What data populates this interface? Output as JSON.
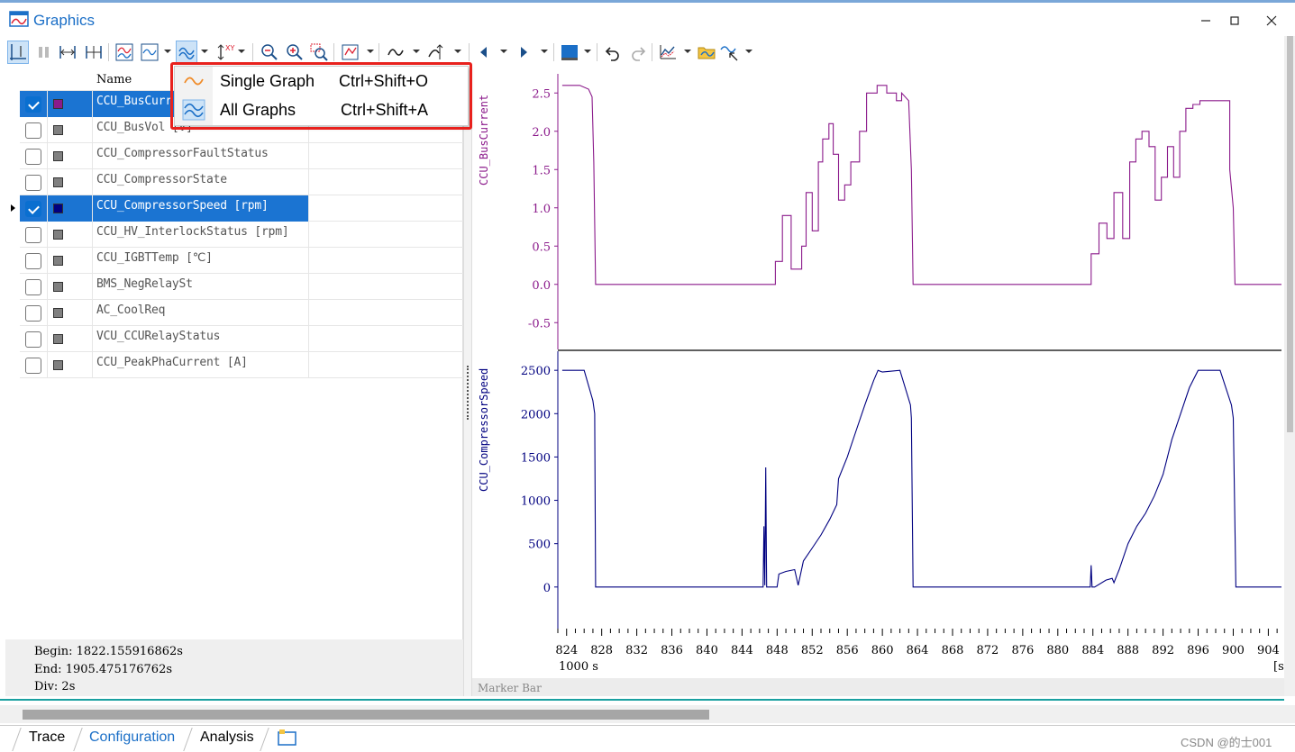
{
  "window": {
    "title": "Graphics",
    "controls": [
      "minimize-icon",
      "maximize-icon",
      "close-icon"
    ]
  },
  "toolbar": {
    "icons": [
      "layout-icon",
      "pause-icon",
      "fit-x-icon",
      "fit-xy-icon",
      "graph-mode-icon",
      "signal-mode-icon",
      "graph-layout-icon",
      "scale-icon",
      "zoom-out-icon",
      "zoom-in-icon",
      "zoom-rect-icon",
      "measure-icon",
      "curve-icon",
      "cursor-icon",
      "prev-icon",
      "next-icon",
      "background-icon",
      "undo-icon",
      "redo-icon",
      "chart-options-icon",
      "export-icon",
      "signal-config-icon"
    ]
  },
  "menu": {
    "items": [
      {
        "label": "Single Graph",
        "shortcut": "Ctrl+Shift+O",
        "icon": "single-graph-icon"
      },
      {
        "label": "All Graphs",
        "shortcut": "Ctrl+Shift+A",
        "icon": "all-graphs-icon"
      }
    ]
  },
  "signal_list": {
    "header_name": "Name",
    "rows": [
      {
        "name": "CCU_BusCurr",
        "checked": true,
        "color": "#8b1a8b",
        "selected": true
      },
      {
        "name": "CCU_BusVol    [V]",
        "checked": false,
        "color": "#808080",
        "selected": false
      },
      {
        "name": "CCU_CompressorFaultStatus",
        "checked": false,
        "color": "#808080",
        "selected": false
      },
      {
        "name": "CCU_CompressorState",
        "checked": false,
        "color": "#808080",
        "selected": false
      },
      {
        "name": "CCU_CompressorSpeed [rpm]",
        "checked": true,
        "color": "#000080",
        "selected": true
      },
      {
        "name": "CCU_HV_InterlockStatus [rpm]",
        "checked": false,
        "color": "#808080",
        "selected": false
      },
      {
        "name": "CCU_IGBTTemp [℃]",
        "checked": false,
        "color": "#808080",
        "selected": false
      },
      {
        "name": "BMS_NegRelaySt",
        "checked": false,
        "color": "#808080",
        "selected": false
      },
      {
        "name": "AC_CoolReq",
        "checked": false,
        "color": "#808080",
        "selected": false
      },
      {
        "name": "VCU_CCURelayStatus",
        "checked": false,
        "color": "#808080",
        "selected": false
      },
      {
        "name": "CCU_PeakPhaCurrent [A]",
        "checked": false,
        "color": "#808080",
        "selected": false
      }
    ]
  },
  "status": {
    "begin": "Begin: 1822.155916862s",
    "end": "End: 1905.475176762s",
    "div": "Div: 2s"
  },
  "marker_bar": "Marker Bar",
  "tabs": [
    {
      "label": "Trace",
      "active": false
    },
    {
      "label": "Configuration",
      "active": true
    },
    {
      "label": "Analysis",
      "active": false
    }
  ],
  "watermark": "CSDN @的士001",
  "chart_data": [
    {
      "type": "line",
      "ylabel": "CCU_BusCurrent",
      "color": "#8b1a8b",
      "ylim": [
        -0.85,
        2.75
      ],
      "yticks": [
        "2.5",
        "2.0",
        "1.5",
        "1.0",
        "0.5",
        "0.0",
        "-0.5"
      ],
      "x": [
        823.5,
        825.5,
        826.5,
        826.9,
        827.1,
        827.3,
        847.8,
        847.8,
        848.6,
        848.6,
        849.6,
        849.6,
        850.8,
        850.8,
        851.3,
        851.3,
        852.0,
        852.0,
        852.7,
        852.7,
        853.2,
        853.2,
        853.9,
        853.9,
        854.4,
        854.4,
        855.0,
        855.0,
        855.7,
        855.7,
        856.4,
        856.4,
        857.4,
        857.4,
        858.2,
        858.2,
        859.4,
        859.4,
        860.5,
        860.5,
        861.6,
        861.6,
        862.2,
        862.2,
        863.0,
        863.3,
        863.5,
        883.8,
        883.8,
        884.7,
        884.7,
        885.6,
        885.6,
        886.4,
        886.4,
        887.4,
        887.4,
        888.2,
        888.2,
        888.9,
        888.9,
        889.6,
        889.6,
        890.4,
        890.4,
        891.1,
        891.1,
        891.8,
        891.8,
        892.5,
        892.5,
        893.2,
        893.2,
        893.9,
        893.9,
        894.6,
        894.6,
        895.4,
        895.4,
        896.2,
        896.2,
        899.6,
        899.6,
        900.0,
        900.2,
        900.5,
        905.5
      ],
      "y": [
        2.6,
        2.6,
        2.55,
        2.45,
        1.6,
        0.0,
        0.0,
        0.3,
        0.3,
        0.9,
        0.9,
        0.2,
        0.2,
        0.5,
        0.5,
        1.2,
        1.2,
        0.7,
        0.7,
        1.6,
        1.6,
        1.9,
        1.9,
        2.1,
        2.1,
        1.7,
        1.7,
        1.1,
        1.1,
        1.3,
        1.3,
        1.6,
        1.6,
        2.0,
        2.0,
        2.5,
        2.5,
        2.6,
        2.6,
        2.5,
        2.5,
        2.4,
        2.4,
        2.5,
        2.4,
        1.5,
        0.0,
        0.0,
        0.4,
        0.4,
        0.8,
        0.8,
        0.6,
        0.6,
        1.2,
        1.2,
        0.6,
        0.6,
        1.6,
        1.6,
        1.9,
        1.9,
        2.0,
        2.0,
        1.8,
        1.8,
        1.1,
        1.1,
        1.4,
        1.4,
        1.8,
        1.8,
        1.4,
        1.4,
        2.0,
        2.0,
        2.3,
        2.3,
        2.35,
        2.35,
        2.4,
        2.4,
        1.5,
        1.0,
        0.0,
        0.0,
        0.0
      ]
    },
    {
      "type": "line",
      "ylabel": "CCU_CompressorSpeed",
      "color": "#000080",
      "ylim": [
        -480,
        2720
      ],
      "yticks": [
        "2500",
        "2000",
        "1500",
        "1000",
        "500",
        "0"
      ],
      "x": [
        823.5,
        826.0,
        827.0,
        827.2,
        827.3,
        846.4,
        846.5,
        846.6,
        846.7,
        846.8,
        847.0,
        848.0,
        848.2,
        849.0,
        850.0,
        850.4,
        851.0,
        852.0,
        853.0,
        854.0,
        854.8,
        855.0,
        856.0,
        857.0,
        858.0,
        859.0,
        859.5,
        860.0,
        862.0,
        863.2,
        863.3,
        863.5,
        883.7,
        883.8,
        883.9,
        884.2,
        885.5,
        886.2,
        886.4,
        887.0,
        888.0,
        889.0,
        890.0,
        891.0,
        892.0,
        892.5,
        893.0,
        894.0,
        895.0,
        896.0,
        896.5,
        898.5,
        899.8,
        900.0,
        900.3,
        905.5
      ],
      "y": [
        2500,
        2500,
        2150,
        2000,
        0,
        0,
        700,
        20,
        1380,
        0,
        0,
        0,
        150,
        180,
        200,
        20,
        300,
        450,
        600,
        780,
        950,
        1250,
        1500,
        1800,
        2100,
        2380,
        2500,
        2480,
        2500,
        2100,
        1950,
        0,
        0,
        250,
        0,
        0,
        80,
        100,
        50,
        200,
        500,
        700,
        850,
        1050,
        1300,
        1500,
        1700,
        2000,
        2300,
        2500,
        2500,
        2500,
        2100,
        1950,
        0,
        0
      ],
      "xlim": [
        823.0,
        905.5
      ],
      "xticks": [
        "824",
        "828",
        "832",
        "836",
        "840",
        "844",
        "848",
        "852",
        "856",
        "860",
        "864",
        "868",
        "872",
        "876",
        "880",
        "884",
        "888",
        "892",
        "896",
        "900",
        "904"
      ],
      "xlabel": "1000 s",
      "xunit": "[s"
    }
  ]
}
